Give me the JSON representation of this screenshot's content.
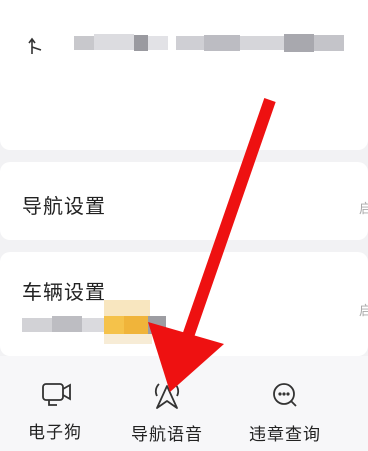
{
  "sections": {
    "nav_settings": {
      "title": "导航设置",
      "hint": "启"
    },
    "vehicle_settings": {
      "title": "车辆设置",
      "hint": "启"
    }
  },
  "toolbar": {
    "items": [
      {
        "label": "电子狗",
        "icon": "dashcam-icon"
      },
      {
        "label": "导航语音",
        "icon": "nav-voice-icon"
      },
      {
        "label": "违章查询",
        "icon": "violation-query-icon"
      }
    ]
  },
  "colors": {
    "annotation_arrow": "#ee1111",
    "blur_accent": "#f5c24a",
    "background": "#f2f2f4"
  }
}
